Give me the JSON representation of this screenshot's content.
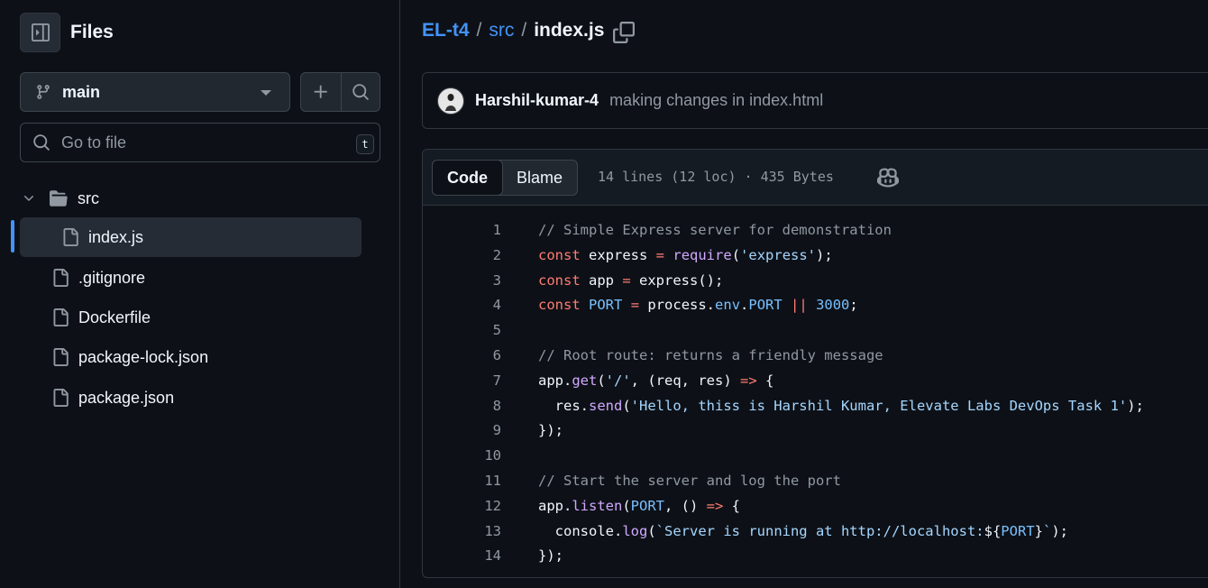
{
  "sidebar": {
    "title": "Files",
    "branch": "main",
    "search_placeholder": "Go to file",
    "search_shortcut": "t",
    "tree": [
      {
        "label": "src",
        "type": "folder"
      },
      {
        "label": "index.js",
        "type": "file",
        "selected": true
      },
      {
        "label": ".gitignore",
        "type": "file"
      },
      {
        "label": "Dockerfile",
        "type": "file"
      },
      {
        "label": "package-lock.json",
        "type": "file"
      },
      {
        "label": "package.json",
        "type": "file"
      }
    ]
  },
  "breadcrumb": {
    "repo": "EL-t4",
    "sep1": "/",
    "dir": "src",
    "sep2": "/",
    "file": "index.js"
  },
  "commit": {
    "author": "Harshil-kumar-4",
    "message": "making changes in index.html"
  },
  "code_view": {
    "tab_code": "Code",
    "tab_blame": "Blame",
    "meta": "14 lines (12 loc) · 435 Bytes",
    "lines": [
      [
        {
          "t": "// Simple Express server for demonstration",
          "c": "cm"
        }
      ],
      [
        {
          "t": "const",
          "c": "kw"
        },
        {
          "t": " express ",
          "c": "pl"
        },
        {
          "t": "=",
          "c": "kw"
        },
        {
          "t": " ",
          "c": "pl"
        },
        {
          "t": "require",
          "c": "fn"
        },
        {
          "t": "(",
          "c": "pl"
        },
        {
          "t": "'express'",
          "c": "str"
        },
        {
          "t": ");",
          "c": "pl"
        }
      ],
      [
        {
          "t": "const",
          "c": "kw"
        },
        {
          "t": " app ",
          "c": "pl"
        },
        {
          "t": "=",
          "c": "kw"
        },
        {
          "t": " express();",
          "c": "pl"
        }
      ],
      [
        {
          "t": "const",
          "c": "kw"
        },
        {
          "t": " ",
          "c": "pl"
        },
        {
          "t": "PORT",
          "c": "cn"
        },
        {
          "t": " ",
          "c": "pl"
        },
        {
          "t": "=",
          "c": "kw"
        },
        {
          "t": " process.",
          "c": "pl"
        },
        {
          "t": "env",
          "c": "cn"
        },
        {
          "t": ".",
          "c": "pl"
        },
        {
          "t": "PORT",
          "c": "cn"
        },
        {
          "t": " ",
          "c": "pl"
        },
        {
          "t": "||",
          "c": "kw"
        },
        {
          "t": " ",
          "c": "pl"
        },
        {
          "t": "3000",
          "c": "cn"
        },
        {
          "t": ";",
          "c": "pl"
        }
      ],
      [],
      [
        {
          "t": "// Root route: returns a friendly message",
          "c": "cm"
        }
      ],
      [
        {
          "t": "app.",
          "c": "pl"
        },
        {
          "t": "get",
          "c": "fn"
        },
        {
          "t": "(",
          "c": "pl"
        },
        {
          "t": "'/'",
          "c": "str"
        },
        {
          "t": ", (req, res) ",
          "c": "pl"
        },
        {
          "t": "=>",
          "c": "kw"
        },
        {
          "t": " {",
          "c": "pl"
        }
      ],
      [
        {
          "t": "  res.",
          "c": "pl"
        },
        {
          "t": "send",
          "c": "fn"
        },
        {
          "t": "(",
          "c": "pl"
        },
        {
          "t": "'Hello, thiss is Harshil Kumar, Elevate Labs DevOps Task 1'",
          "c": "str"
        },
        {
          "t": ");",
          "c": "pl"
        }
      ],
      [
        {
          "t": "});",
          "c": "pl"
        }
      ],
      [],
      [
        {
          "t": "// Start the server and log the port",
          "c": "cm"
        }
      ],
      [
        {
          "t": "app.",
          "c": "pl"
        },
        {
          "t": "listen",
          "c": "fn"
        },
        {
          "t": "(",
          "c": "pl"
        },
        {
          "t": "PORT",
          "c": "cn"
        },
        {
          "t": ", () ",
          "c": "pl"
        },
        {
          "t": "=>",
          "c": "kw"
        },
        {
          "t": " {",
          "c": "pl"
        }
      ],
      [
        {
          "t": "  console.",
          "c": "pl"
        },
        {
          "t": "log",
          "c": "fn"
        },
        {
          "t": "(",
          "c": "pl"
        },
        {
          "t": "`Server is running at http://localhost:",
          "c": "str"
        },
        {
          "t": "${",
          "c": "pl"
        },
        {
          "t": "PORT",
          "c": "cn"
        },
        {
          "t": "}",
          "c": "pl"
        },
        {
          "t": "`",
          "c": "str"
        },
        {
          "t": ");",
          "c": "pl"
        }
      ],
      [
        {
          "t": "});",
          "c": "pl"
        }
      ]
    ]
  },
  "colors": {
    "cm": "#9198a1",
    "kw": "#ff7b72",
    "fn": "#d2a8ff",
    "str": "#a5d6ff",
    "cn": "#79c0ff",
    "pl": "#f0f6fc",
    "accent": "#4493f8"
  },
  "icons": {
    "sidebar_toggle": "sidebar-collapse-icon",
    "branch": "git-branch-icon",
    "add": "plus-icon",
    "search": "search-icon",
    "folder": "folder-icon",
    "file": "file-icon",
    "copy": "copy-icon",
    "copilot": "copilot-icon"
  }
}
